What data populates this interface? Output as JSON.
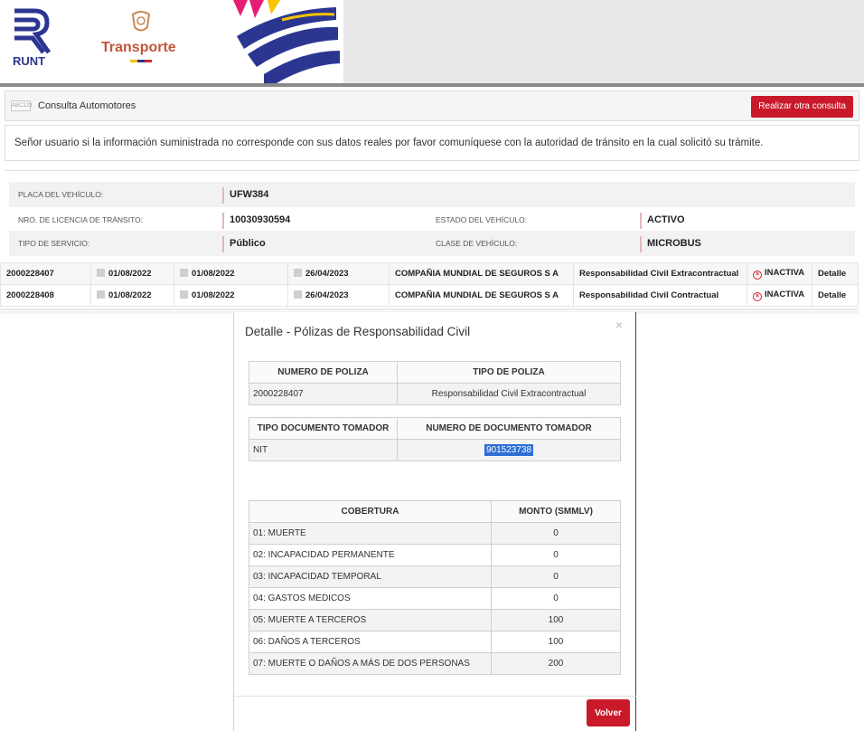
{
  "header": {
    "runt_label": "RUNT",
    "transporte_label": "Transporte"
  },
  "consulta": {
    "icon_text": "ABC123",
    "title": "Consulta Automotores",
    "otra_consulta_label": "Realizar otra consulta"
  },
  "notice": "Señor usuario si la información suministrada no corresponde con sus datos reales por favor comuníquese con la autoridad de tránsito en la cual solicitó su trámite.",
  "vehicle": {
    "placa_label": "PLACA DEL VEHÍCULO:",
    "placa_value": "UFW384",
    "licencia_label": "NRO. DE LICENCIA DE TRÁNSITO:",
    "licencia_value": "10030930594",
    "estado_label": "ESTADO DEL VEHÍCULO:",
    "estado_value": "ACTIVO",
    "servicio_label": "TIPO DE SERVICIO:",
    "servicio_value": "Público",
    "clase_label": "CLASE DE VEHÍCULO:",
    "clase_value": "MICROBUS"
  },
  "polizas": [
    {
      "numero": "2000228407",
      "fecha1": "01/08/2022",
      "fecha2": "01/08/2022",
      "fecha3": "26/04/2023",
      "aseguradora": "COMPAÑIA MUNDIAL DE SEGUROS S A",
      "tipo": "Responsabilidad Civil Extracontractual",
      "estado": "INACTIVA",
      "detalle": "Detalle"
    },
    {
      "numero": "2000228408",
      "fecha1": "01/08/2022",
      "fecha2": "01/08/2022",
      "fecha3": "26/04/2023",
      "aseguradora": "COMPAÑIA MUNDIAL DE SEGUROS S A",
      "tipo": "Responsabilidad Civil Contractual",
      "estado": "INACTIVA",
      "detalle": "Detalle"
    }
  ],
  "modal": {
    "title": "Detalle - Pólizas de Responsabilidad Civil",
    "close": "×",
    "poliza_headers": [
      "NUMERO DE POLIZA",
      "TIPO DE POLIZA"
    ],
    "poliza_row": [
      "2000228407",
      "Responsabilidad Civil Extracontractual"
    ],
    "tomador_headers": [
      "TIPO DOCUMENTO TOMADOR",
      "NUMERO DE DOCUMENTO TOMADOR"
    ],
    "tomador_row": [
      "NIT",
      "901523738"
    ],
    "cobertura_headers": [
      "COBERTURA",
      "MONTO (SMMLV)"
    ],
    "coberturas": [
      [
        "01: MUERTE",
        "0"
      ],
      [
        "02: INCAPACIDAD PERMANENTE",
        "0"
      ],
      [
        "03: INCAPACIDAD TEMPORAL",
        "0"
      ],
      [
        "04: GASTOS MEDICOS",
        "0"
      ],
      [
        "05: MUERTE A TERCEROS",
        "100"
      ],
      [
        "06: DAÑOS A TERCEROS",
        "100"
      ],
      [
        "07: MUERTE O DAÑOS A MÁS DE DOS PERSONAS",
        "200"
      ]
    ],
    "volver_label": "Volver"
  }
}
